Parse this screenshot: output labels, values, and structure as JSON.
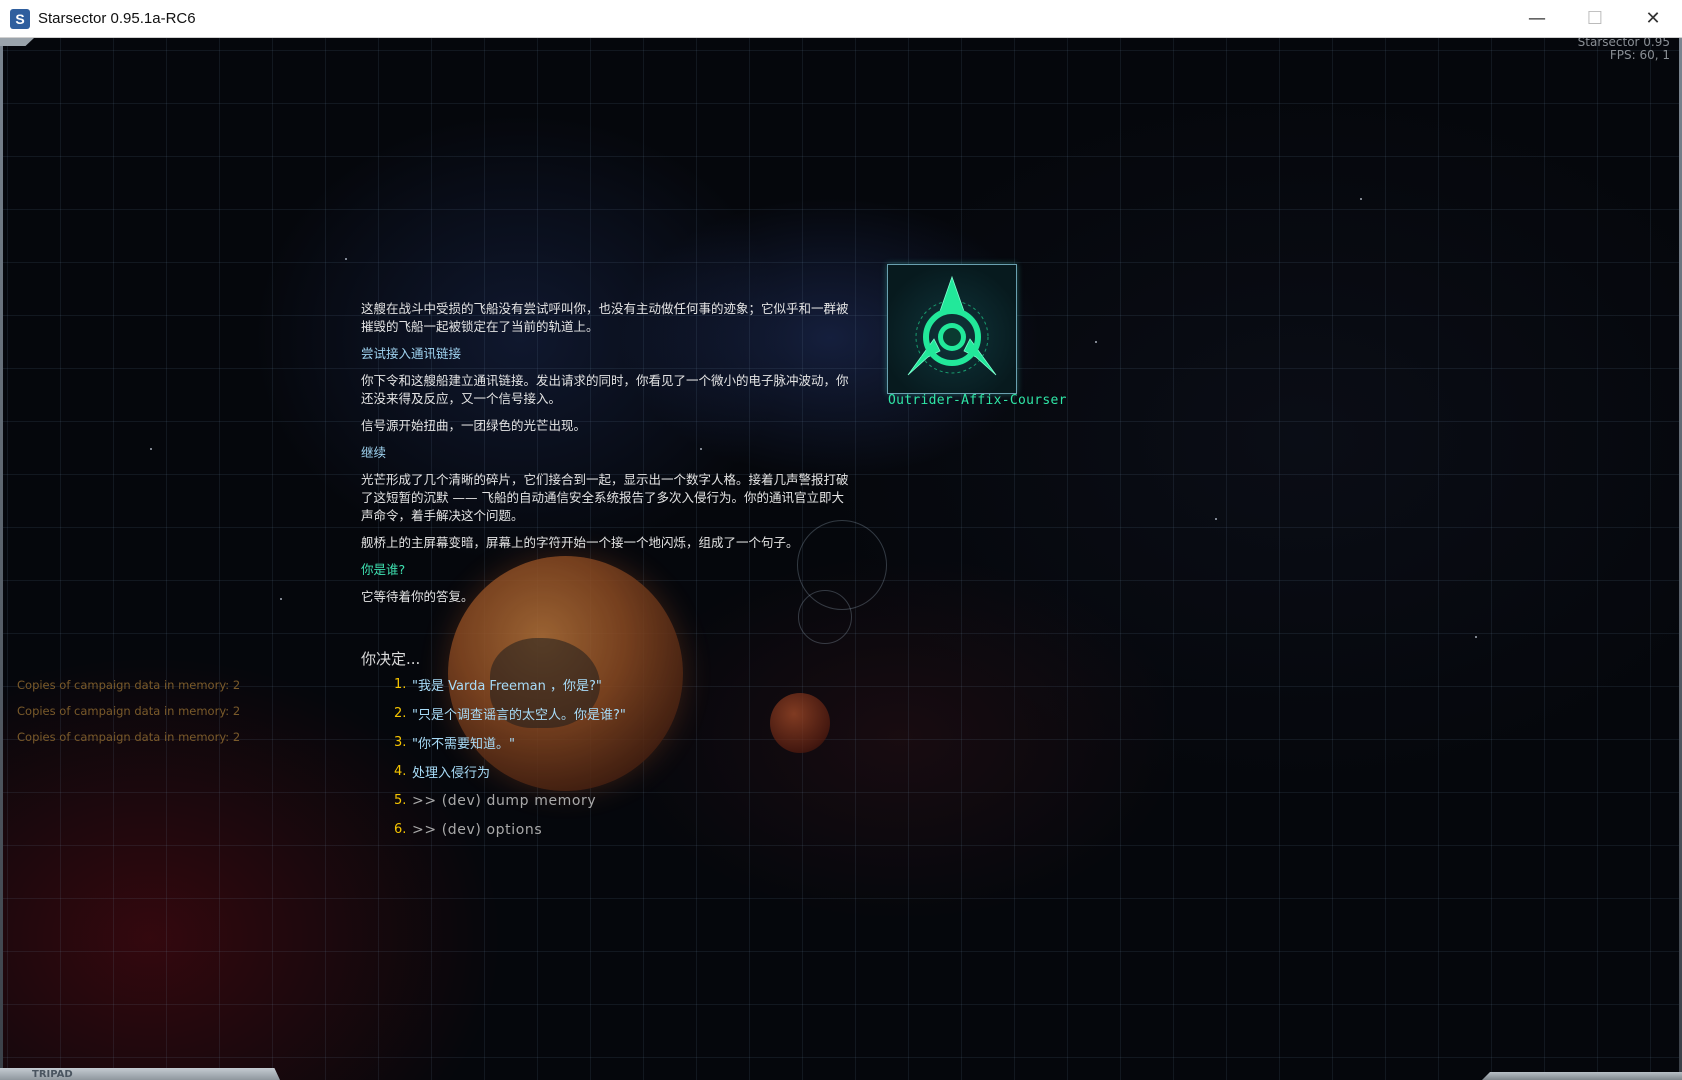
{
  "window": {
    "title": "Starsector 0.95.1a-RC6",
    "app_icon_glyph": "S",
    "minimize_glyph": "—",
    "maximize_glyph": "☐",
    "close_glyph": "✕"
  },
  "overlay": {
    "version_text": "Starsector 0.95",
    "fps_text": "FPS: 60, 1"
  },
  "memory_log": [
    "Copies of campaign data in memory: 2",
    "Copies of campaign data in memory: 2",
    "Copies of campaign data in memory: 2"
  ],
  "story": {
    "p1": "这艘在战斗中受损的飞船没有尝试呼叫你，也没有主动做任何事的迹象；它似乎和一群被摧毁的飞船一起被锁定在了当前的轨道上。",
    "choice1": "尝试接入通讯链接",
    "p2": "你下令和这艘船建立通讯链接。发出请求的同时，你看见了一个微小的电子脉冲波动，你还没来得及反应，又一个信号接入。",
    "p3": "信号源开始扭曲，一团绿色的光芒出现。",
    "choice2": "继续",
    "p4": "光芒形成了几个清晰的碎片，它们接合到一起，显示出一个数字人格。接着几声警报打破了这短暂的沉默 —— 飞船的自动通信安全系统报告了多次入侵行为。你的通讯官立即大声命令，着手解决这个问题。",
    "p5": "舰桥上的主屏幕变暗，屏幕上的字符开始一个接一个地闪烁，组成了一个句子。",
    "highlight": "你是谁?",
    "p6": "它等待着你的答复。"
  },
  "portrait": {
    "name": "Outrider-Affix-Courser",
    "icon": "ai-core-triangle-icon"
  },
  "dialog": {
    "prompt": "你决定...",
    "options": [
      {
        "num": "1.",
        "text": "\"我是 Varda Freeman ，你是?\""
      },
      {
        "num": "2.",
        "text": "\"只是个调查谣言的太空人。你是谁?\""
      },
      {
        "num": "3.",
        "text": "\"你不需要知道。\""
      },
      {
        "num": "4.",
        "text": "处理入侵行为"
      },
      {
        "num": "5.",
        "text": ">> (dev) dump memory"
      },
      {
        "num": "6.",
        "text": ">> (dev) options"
      }
    ]
  },
  "bottom": {
    "logo_text": "TRIPAD"
  },
  "colors": {
    "accent_green": "#2fe6a6",
    "option_number": "#f5c400",
    "option_text": "#a8dcf8",
    "dev_option_text": "#a9a9a9",
    "memory_log_text": "#7a5a2a"
  }
}
